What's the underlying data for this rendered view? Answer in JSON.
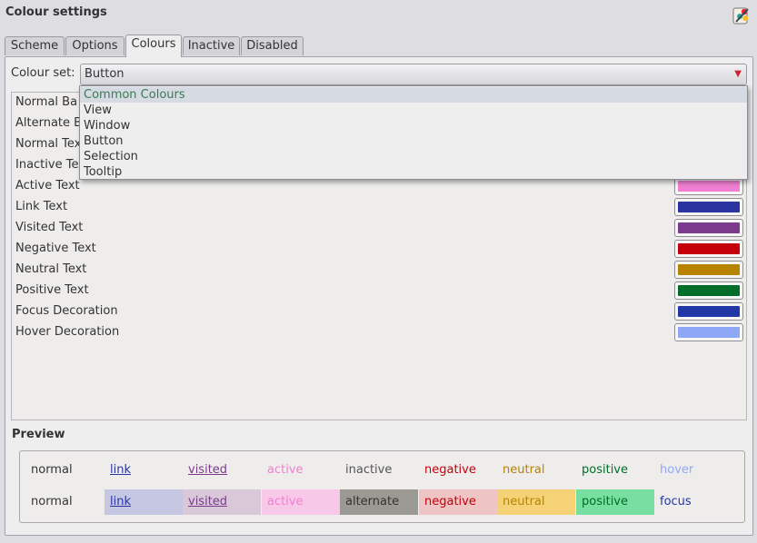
{
  "window": {
    "title": "Colour settings"
  },
  "tabs": [
    {
      "label": "Scheme"
    },
    {
      "label": "Options"
    },
    {
      "label": "Colours"
    },
    {
      "label": "Inactive"
    },
    {
      "label": "Disabled"
    }
  ],
  "colour_set": {
    "label": "Colour set:",
    "selected": "Button",
    "options": [
      "Common Colours",
      "View",
      "Window",
      "Button",
      "Selection",
      "Tooltip"
    ]
  },
  "roles": [
    {
      "label": "Normal Background",
      "visible": "Normal Ba",
      "color": ""
    },
    {
      "label": "Alternate Background",
      "visible": "Alternate B",
      "color": ""
    },
    {
      "label": "Normal Text",
      "visible": "Normal Tex",
      "color": ""
    },
    {
      "label": "Inactive Text",
      "visible": "Inactive Tex",
      "color": ""
    },
    {
      "label": "Active Text",
      "visible": "Active Text",
      "color": "#f07fd1"
    },
    {
      "label": "Link Text",
      "visible": "Link Text",
      "color": "#2a34a0"
    },
    {
      "label": "Visited Text",
      "visible": "Visited Text",
      "color": "#7b3b8d"
    },
    {
      "label": "Negative Text",
      "visible": "Negative Text",
      "color": "#c4000a"
    },
    {
      "label": "Neutral Text",
      "visible": "Neutral Text",
      "color": "#b88300"
    },
    {
      "label": "Positive Text",
      "visible": "Positive Text",
      "color": "#006e2a"
    },
    {
      "label": "Focus Decoration",
      "visible": "Focus Decoration",
      "color": "#2237a6"
    },
    {
      "label": "Hover Decoration",
      "visible": "Hover Decoration",
      "color": "#8fa8f5"
    }
  ],
  "preview": {
    "label": "Preview",
    "row1": [
      {
        "text": "normal",
        "fg": "#333333",
        "bg": "",
        "underline": false
      },
      {
        "text": "link",
        "fg": "#2a34a0",
        "bg": "",
        "underline": true
      },
      {
        "text": "visited",
        "fg": "#7b3b8d",
        "bg": "",
        "underline": true
      },
      {
        "text": "active",
        "fg": "#f07fd1",
        "bg": "",
        "underline": false
      },
      {
        "text": "inactive",
        "fg": "#555555",
        "bg": "",
        "underline": false
      },
      {
        "text": "negative",
        "fg": "#c4000a",
        "bg": "",
        "underline": false
      },
      {
        "text": "neutral",
        "fg": "#b88300",
        "bg": "",
        "underline": false
      },
      {
        "text": "positive",
        "fg": "#006e2a",
        "bg": "",
        "underline": false
      },
      {
        "text": "hover",
        "fg": "#8fa8f5",
        "bg": "",
        "underline": false
      }
    ],
    "row2": [
      {
        "text": "normal",
        "fg": "#333333",
        "bg": "",
        "underline": false
      },
      {
        "text": "link",
        "fg": "#2a34a0",
        "bg": "#c4c6e2",
        "underline": true
      },
      {
        "text": "visited",
        "fg": "#7b3b8d",
        "bg": "#d8c8d8",
        "underline": true
      },
      {
        "text": "active",
        "fg": "#f07fd1",
        "bg": "#f8c8e8",
        "underline": false
      },
      {
        "text": "alternate",
        "fg": "#333333",
        "bg": "#9a9994",
        "underline": false
      },
      {
        "text": "negative",
        "fg": "#c4000a",
        "bg": "#eec4c4",
        "underline": false
      },
      {
        "text": "neutral",
        "fg": "#b88300",
        "bg": "#f5d276",
        "underline": false
      },
      {
        "text": "positive",
        "fg": "#006e2a",
        "bg": "#77e0a0",
        "underline": false
      },
      {
        "text": "focus",
        "fg": "#2237a6",
        "bg": "",
        "underline": false
      }
    ]
  }
}
